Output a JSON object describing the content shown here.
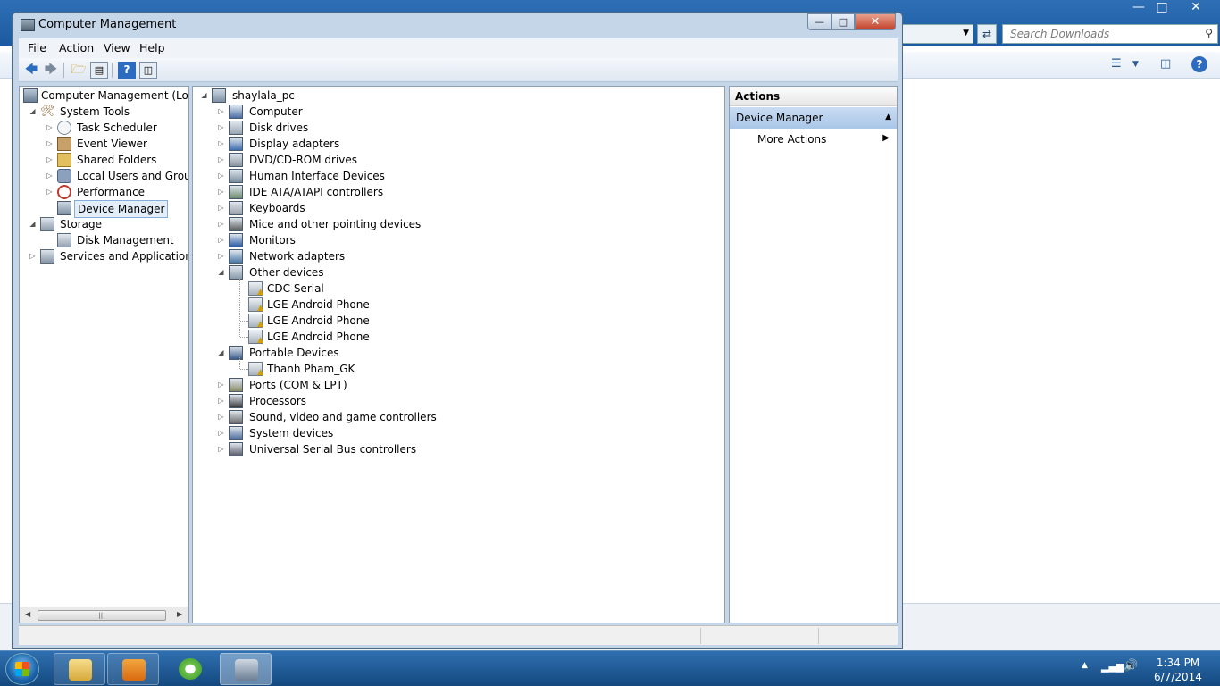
{
  "background_window": {
    "search_placeholder": "Search Downloads"
  },
  "window": {
    "title": "Computer Management",
    "menu": [
      "File",
      "Action",
      "View",
      "Help"
    ]
  },
  "left_tree": {
    "root": "Computer Management (Local",
    "system_tools": "System Tools",
    "task_scheduler": "Task Scheduler",
    "event_viewer": "Event Viewer",
    "shared_folders": "Shared Folders",
    "local_users": "Local Users and Groups",
    "performance": "Performance",
    "device_manager": "Device Manager",
    "storage": "Storage",
    "disk_management": "Disk Management",
    "services": "Services and Applications"
  },
  "device_tree": {
    "root": "shaylala_pc",
    "categories": [
      "Computer",
      "Disk drives",
      "Display adapters",
      "DVD/CD-ROM drives",
      "Human Interface Devices",
      "IDE ATA/ATAPI controllers",
      "Keyboards",
      "Mice and other pointing devices",
      "Monitors",
      "Network adapters",
      "Other devices",
      "Portable Devices",
      "Ports (COM & LPT)",
      "Processors",
      "Sound, video and game controllers",
      "System devices",
      "Universal Serial Bus controllers"
    ],
    "other_devices_children": [
      "CDC Serial",
      "LGE Android Phone",
      "LGE Android Phone",
      "LGE Android Phone"
    ],
    "portable_devices_children": [
      "Thanh Pham_GK"
    ]
  },
  "actions": {
    "header": "Actions",
    "section": "Device Manager",
    "more": "More Actions"
  },
  "taskbar": {
    "time": "1:34 PM",
    "date": "6/7/2014"
  }
}
